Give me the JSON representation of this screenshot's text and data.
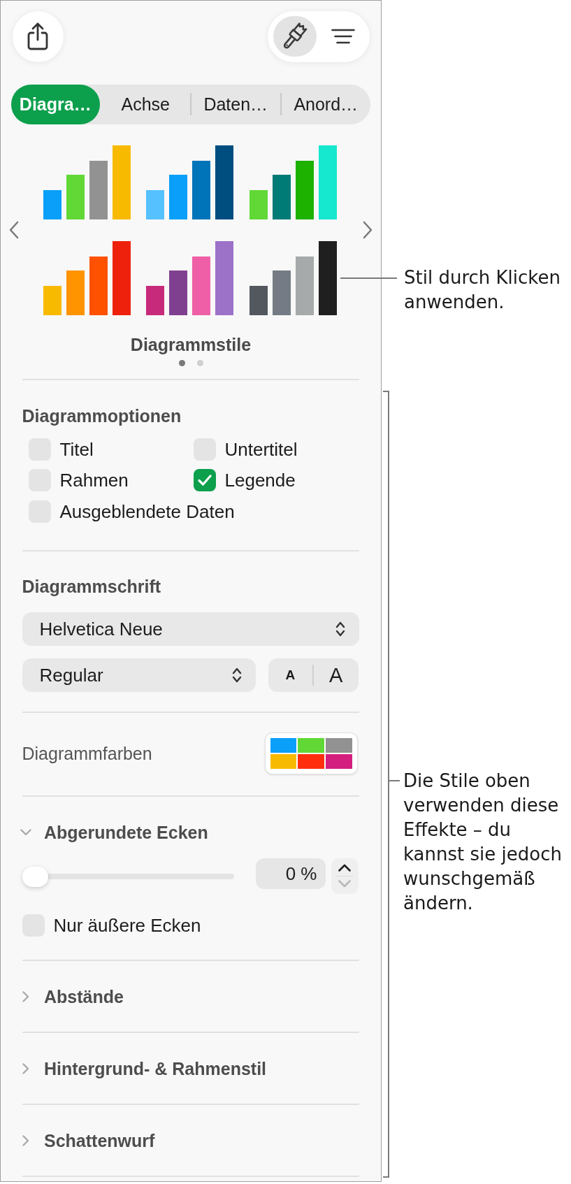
{
  "toolbar": {
    "tools": [
      {
        "selected": true
      },
      {
        "selected": false
      }
    ]
  },
  "tabs": [
    {
      "label": "Diagra…",
      "selected": true
    },
    {
      "label": "Achse",
      "selected": false
    },
    {
      "label": "Daten…",
      "selected": false
    },
    {
      "label": "Anord…",
      "selected": false
    }
  ],
  "chart_styles": {
    "title": "Diagrammstile",
    "items": [
      {
        "bars": [
          {
            "color": "#0a9ff8"
          },
          {
            "color": "#61d836"
          },
          {
            "color": "#929292"
          },
          {
            "color": "#f8ba00"
          }
        ]
      },
      {
        "bars": [
          {
            "color": "#56c1ff"
          },
          {
            "color": "#0a9ff8"
          },
          {
            "color": "#0074b9"
          },
          {
            "color": "#004d7f"
          }
        ]
      },
      {
        "bars": [
          {
            "color": "#61d836"
          },
          {
            "color": "#017b76"
          },
          {
            "color": "#1db100"
          },
          {
            "color": "#16e7cf"
          }
        ]
      },
      {
        "bars": [
          {
            "color": "#f8ba00"
          },
          {
            "color": "#ff9300"
          },
          {
            "color": "#fe5200"
          },
          {
            "color": "#ee220c"
          }
        ]
      },
      {
        "bars": [
          {
            "color": "#c82a7b"
          },
          {
            "color": "#804090"
          },
          {
            "color": "#ef5fa7"
          },
          {
            "color": "#9c72c9"
          }
        ]
      },
      {
        "bars": [
          {
            "color": "#53585f"
          },
          {
            "color": "#747b84"
          },
          {
            "color": "#a6aaab"
          },
          {
            "color": "#1f1f1f"
          }
        ]
      }
    ],
    "pages": [
      {
        "selected": true
      },
      {
        "selected": false
      }
    ]
  },
  "chart_options": {
    "heading": "Diagrammoptionen",
    "options": [
      {
        "label": "Titel",
        "checked": false
      },
      {
        "label": "Untertitel",
        "checked": false
      },
      {
        "label": "Rahmen",
        "checked": false
      },
      {
        "label": "Legende",
        "checked": true
      },
      {
        "label": "Ausgeblendete Daten",
        "checked": false
      }
    ]
  },
  "chart_font": {
    "heading": "Diagrammschrift",
    "family": "Helvetica Neue",
    "style": "Regular",
    "size_buttons": [
      {
        "label": "A"
      },
      {
        "label": "A"
      }
    ]
  },
  "chart_colors": {
    "label": "Diagrammfarben",
    "swatches": [
      {
        "color": "#0a9ff8"
      },
      {
        "color": "#61d836"
      },
      {
        "color": "#929292"
      },
      {
        "color": "#f8ba00"
      },
      {
        "color": "#ff2f0e"
      },
      {
        "color": "#d41e7e"
      }
    ]
  },
  "sections": [
    {
      "title": "Abgerundete Ecken",
      "expanded": true,
      "slider": {
        "level": 0
      },
      "value": "0 %",
      "stepper": {
        "increment_disabled": false,
        "decrement_disabled": true
      },
      "option": {
        "label": "Nur äußere Ecken",
        "checked": false
      }
    },
    {
      "title": "Abstände",
      "expanded": false
    },
    {
      "title": "Hintergrund- & Rahmenstil",
      "expanded": false
    },
    {
      "title": "Schattenwurf",
      "expanded": false
    }
  ],
  "callouts": [
    {
      "kind": "leader",
      "text": "Stil durch Klicken\nanwenden."
    },
    {
      "kind": "bracket",
      "text": "Die Stile oben\nverwenden diese\nEffekte – du\nkannst sie jedoch\nwunschgemäß\nändern."
    }
  ]
}
